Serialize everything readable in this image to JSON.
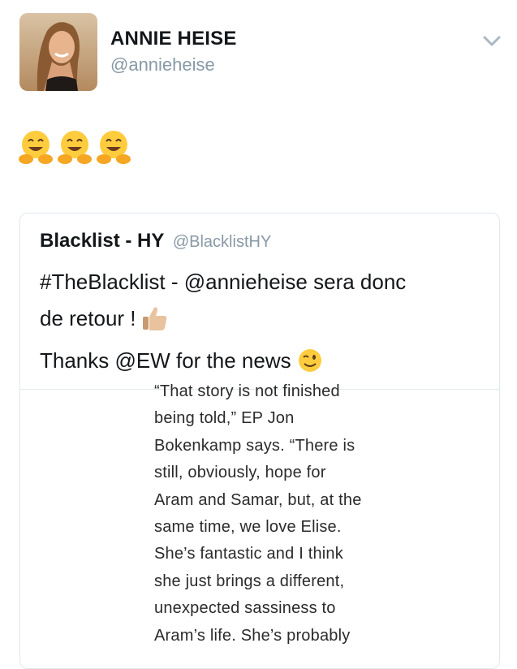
{
  "tweet": {
    "author_name": "ANNIE HEISE",
    "author_handle": "@annieheise",
    "icons": {
      "avatar": "profile-photo",
      "menu": "chevron-down-icon",
      "emojis": [
        "hugging-face-emoji",
        "hugging-face-emoji",
        "hugging-face-emoji"
      ]
    },
    "quoted": {
      "author_name": "Blacklist - HY",
      "author_handle": "@BlacklistHY",
      "text_lines": [
        "#TheBlacklist - @annieheise sera donc",
        "de retour !",
        "Thanks @EW for the news"
      ],
      "inline_emojis": [
        "thumbs-up-emoji",
        "winking-face-emoji"
      ],
      "article_lines": [
        "“That story is not finished",
        "being told,” EP Jon",
        "Bokenkamp says. “There is",
        "still, obviously, hope for",
        "Aram and Samar, but, at the",
        "same time, we love Elise.",
        "She’s fantastic and I think",
        "she just brings a different,",
        "unexpected sassiness to",
        "Aram’s life. She’s probably"
      ]
    }
  },
  "colors": {
    "text": "#14171a",
    "secondary": "#8899a6",
    "border": "#e1e8ed"
  }
}
